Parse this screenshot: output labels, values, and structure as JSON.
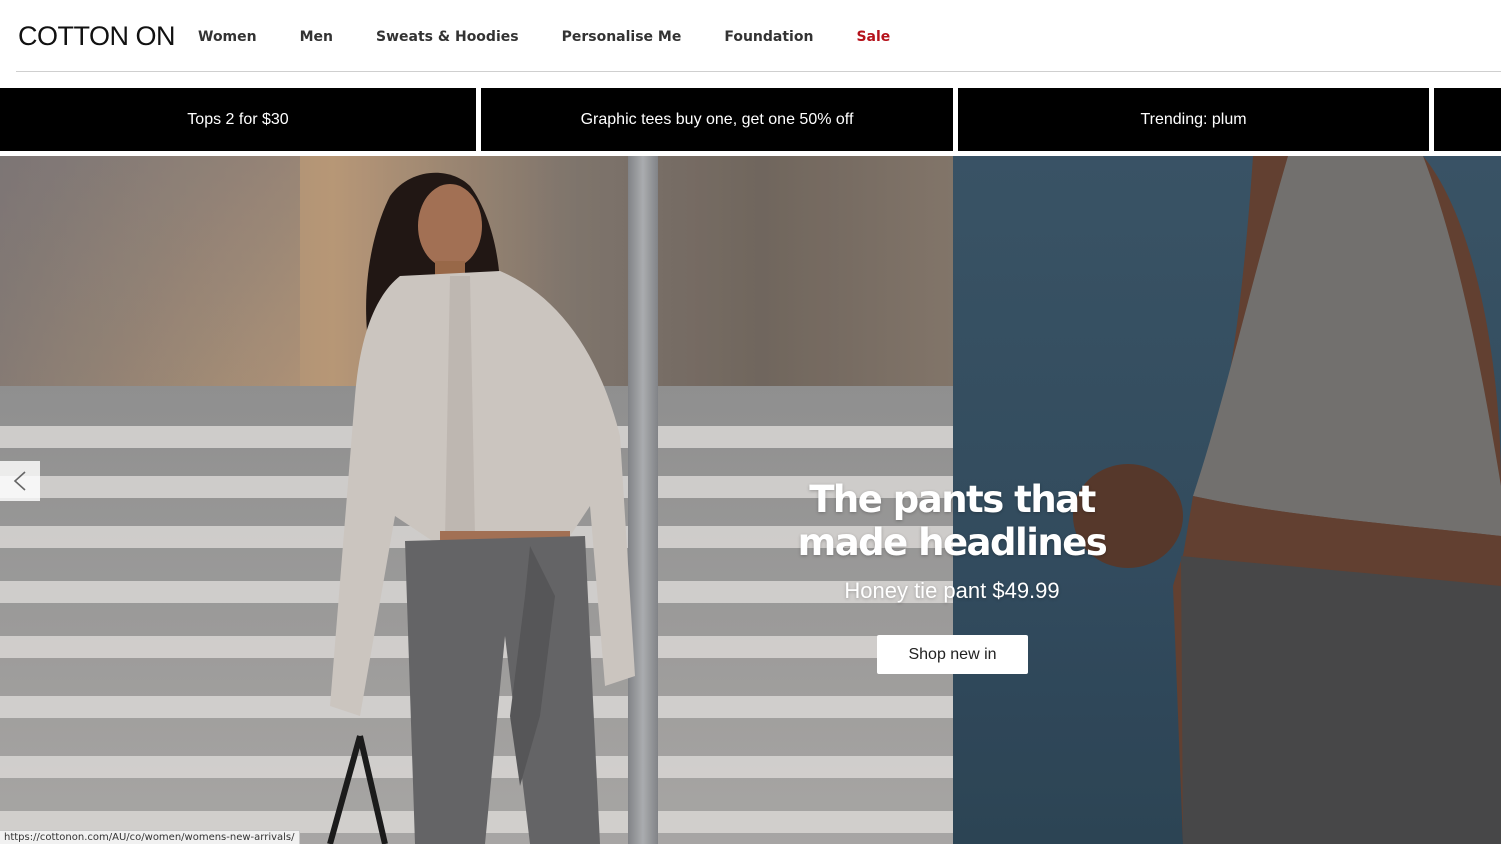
{
  "header": {
    "logo": "COTTON ON",
    "nav": [
      {
        "label": "Women"
      },
      {
        "label": "Men"
      },
      {
        "label": "Sweats & Hoodies"
      },
      {
        "label": "Personalise Me"
      },
      {
        "label": "Foundation"
      },
      {
        "label": "Sale",
        "color": "#b5121b"
      }
    ]
  },
  "promo_strip": {
    "tiles": [
      {
        "label": "Tops 2 for $30"
      },
      {
        "label": "Graphic tees buy one, get one 50% off"
      },
      {
        "label": "Trending: plum"
      },
      {
        "label": ""
      }
    ]
  },
  "hero": {
    "headline_line1": "The pants that",
    "headline_line2": "made headlines",
    "subhead": "Honey tie pant $49.99",
    "cta_label": "Shop new in",
    "prev_icon": "chevron-left-icon"
  },
  "status_bar": {
    "url": "https://cottonon.com/AU/co/women/womens-new-arrivals/"
  },
  "colors": {
    "sale": "#b5121b",
    "promo_bg": "#000000",
    "hero_right_bg": "#3e5a6e"
  }
}
